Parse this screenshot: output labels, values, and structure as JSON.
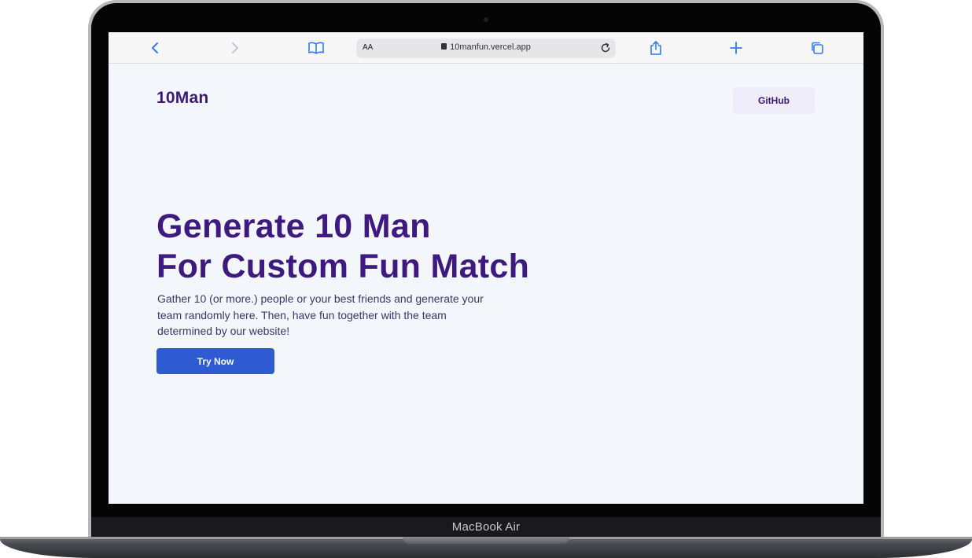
{
  "device": {
    "brand_label": "MacBook Air"
  },
  "browser": {
    "address_bar": {
      "text_size_label": "AA",
      "url": "10manfun.vercel.app"
    },
    "icons": {
      "back": "chevron-left-icon",
      "forward": "chevron-right-icon",
      "bookmarks": "book-icon",
      "lock": "lock-icon",
      "reload": "reload-icon",
      "share": "share-icon",
      "new_tab": "plus-icon",
      "tabs": "tabs-icon"
    },
    "accent_color": "#2f7cf6"
  },
  "page": {
    "logo": "10Man",
    "nav": {
      "github_label": "GitHub"
    },
    "hero": {
      "title_line1": "Generate 10 Man",
      "title_line2": "For Custom Fun Match",
      "description": "Gather 10 (or more.) people or your best friends and generate your team randomly here. Then, have fun together with the team determined by our website!",
      "cta_label": "Try Now"
    },
    "colors": {
      "background": "#f3f7fb",
      "title": "#3e1a80",
      "cta": "#2e5bd1"
    }
  }
}
